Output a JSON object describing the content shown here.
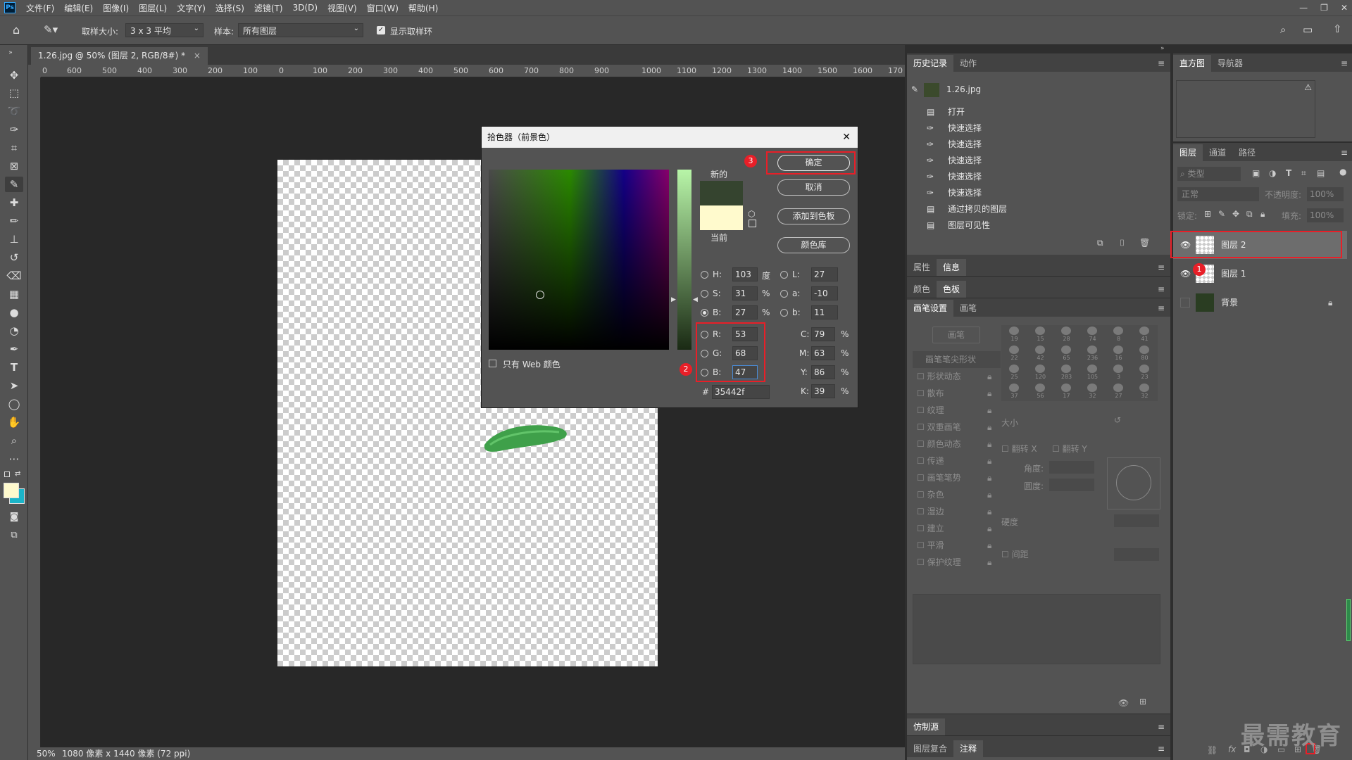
{
  "menu": {
    "items": [
      "文件(F)",
      "编辑(E)",
      "图像(I)",
      "图层(L)",
      "文字(Y)",
      "选择(S)",
      "滤镜(T)",
      "3D(D)",
      "视图(V)",
      "窗口(W)",
      "帮助(H)"
    ],
    "window_controls": [
      "—",
      "❐",
      "✕"
    ]
  },
  "options": {
    "sample_size_label": "取样大小:",
    "sample_size_value": "3 x 3 平均",
    "sample_label": "样本:",
    "sample_value": "所有图层",
    "show_ring_label": "显示取样环"
  },
  "document": {
    "tab_title": "1.26.jpg @ 50% (图层 2, RGB/8#) *",
    "tab_close": "×",
    "ruler_ticks": [
      "0",
      "600",
      "500",
      "400",
      "300",
      "200",
      "100",
      "0",
      "100",
      "200",
      "300",
      "400",
      "500",
      "600",
      "700",
      "800",
      "900",
      "1000",
      "1100",
      "1200",
      "1300",
      "1400",
      "1500",
      "1600",
      "170"
    ],
    "status_zoom": "50%",
    "status_info": "1080 像素 x 1440 像素 (72 ppi)"
  },
  "history_panel": {
    "tabs": [
      "历史记录",
      "动作"
    ],
    "snapshot": "1.26.jpg",
    "items": [
      "打开",
      "快速选择",
      "快速选择",
      "快速选择",
      "快速选择",
      "快速选择",
      "通过拷贝的图层",
      "图层可见性"
    ]
  },
  "histogram_panel": {
    "tabs": [
      "直方图",
      "导航器"
    ]
  },
  "layers_panel": {
    "tabs": [
      "图层",
      "通道",
      "路径"
    ],
    "filter_placeholder": "类型",
    "blend_mode": "正常",
    "opacity_label": "不透明度:",
    "opacity_value": "100%",
    "lock_label": "锁定:",
    "fill_label": "填充:",
    "fill_value": "100%",
    "layers": [
      {
        "name": "图层 2"
      },
      {
        "name": "图层 1"
      },
      {
        "name": "背景"
      }
    ]
  },
  "mid_panels": {
    "props_tabs": [
      "属性",
      "信息"
    ],
    "color_tabs": [
      "颜色",
      "色板"
    ],
    "brush_tabs": [
      "画笔设置",
      "画笔"
    ],
    "brush_button": "画笔",
    "brush_options": [
      "画笔笔尖形状",
      "形状动态",
      "散布",
      "纹理",
      "双重画笔",
      "颜色动态",
      "传递",
      "画笔笔势",
      "杂色",
      "湿边",
      "建立",
      "平滑",
      "保护纹理"
    ],
    "brush_sizes": [
      "19",
      "15",
      "28",
      "74",
      "8",
      "41",
      "22",
      "42",
      "65",
      "236",
      "16",
      "80",
      "25",
      "120",
      "283",
      "105",
      "3",
      "23",
      "37",
      "56",
      "17",
      "32",
      "27",
      "32"
    ],
    "size_label": "大小",
    "flip_x": "翻转 X",
    "flip_y": "翻转 Y",
    "angle_label": "角度:",
    "roundness_label": "圆度:",
    "hardness_label": "硬度",
    "spacing_label": "间距",
    "clone_tabs": [
      "仿制源"
    ],
    "bottom_tabs": [
      "图层复合",
      "注释"
    ]
  },
  "dialog": {
    "title": "拾色器（前景色）",
    "close": "✕",
    "new_label": "新的",
    "current_label": "当前",
    "buttons": {
      "ok": "确定",
      "cancel": "取消",
      "add_swatch": "添加到色板",
      "library": "颜色库"
    },
    "web_only_label": "只有 Web 颜色",
    "fields": {
      "H": {
        "label": "H:",
        "value": "103",
        "unit": "度"
      },
      "S": {
        "label": "S:",
        "value": "31",
        "unit": "%"
      },
      "Bv": {
        "label": "B:",
        "value": "27",
        "unit": "%"
      },
      "R": {
        "label": "R:",
        "value": "53"
      },
      "G": {
        "label": "G:",
        "value": "68"
      },
      "B": {
        "label": "B:",
        "value": "47"
      },
      "L": {
        "label": "L:",
        "value": "27"
      },
      "a": {
        "label": "a:",
        "value": "-10"
      },
      "b": {
        "label": "b:",
        "value": "11"
      },
      "C": {
        "label": "C:",
        "value": "79",
        "unit": "%"
      },
      "M": {
        "label": "M:",
        "value": "63",
        "unit": "%"
      },
      "Y": {
        "label": "Y:",
        "value": "86",
        "unit": "%"
      },
      "K": {
        "label": "K:",
        "value": "39",
        "unit": "%"
      },
      "hex_label": "#",
      "hex": "35442f"
    },
    "colors": {
      "new": "#35442f",
      "current": "#fffacd"
    }
  },
  "annotations": {
    "badge1": "1",
    "badge2": "2",
    "badge3": "3"
  },
  "watermark": "最需教育",
  "colors": {
    "highlight": "#e81f28",
    "panel_bg": "#535353",
    "app_bg": "#282828"
  }
}
